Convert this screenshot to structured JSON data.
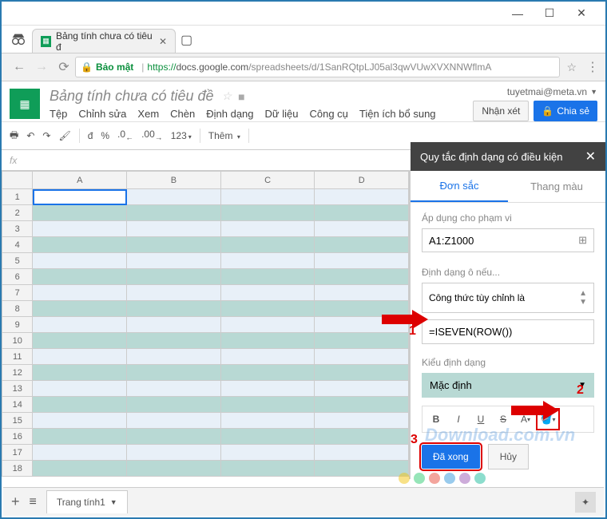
{
  "window": {
    "min": "—",
    "max": "☐",
    "close": "✕"
  },
  "browser": {
    "tab_title": "Bảng tính chưa có tiêu đ",
    "security": "Bảo mật",
    "url_prefix": "https://",
    "url_host": "docs.google.com",
    "url_path": "/spreadsheets/d/1SanRQtpLJ05al3qwVUwXVXNNWflmA"
  },
  "app": {
    "title": "Bảng tính chưa có tiêu đề",
    "email": "tuyetmai@meta.vn",
    "comments_btn": "Nhận xét",
    "share_btn": "Chia sẻ",
    "menus": [
      "Tệp",
      "Chỉnh sửa",
      "Xem",
      "Chèn",
      "Định dạng",
      "Dữ liệu",
      "Công cụ",
      "Tiện ích bổ sung"
    ]
  },
  "toolbar": {
    "currency": "đ",
    "percent": "%",
    "dec_dec": ".0",
    "inc_dec": ".00",
    "numfmt": "123",
    "more": "Thêm"
  },
  "sheet": {
    "columns": [
      "A",
      "B",
      "C",
      "D"
    ],
    "rows": 18,
    "active_tab": "Trang tính1"
  },
  "panel": {
    "title": "Quy tắc định dạng có điều kiện",
    "tab_single": "Đơn sắc",
    "tab_scale": "Thang màu",
    "range_label": "Áp dụng cho phạm vi",
    "range_value": "A1:Z1000",
    "cond_label": "Định dạng ô nếu...",
    "cond_select": "Công thức tùy chỉnh là",
    "formula_value": "=ISEVEN(ROW())",
    "style_label": "Kiểu định dạng",
    "style_preview": "Mặc định",
    "done_btn": "Đã xong",
    "cancel_btn": "Hủy"
  },
  "annotations": {
    "n1": "1",
    "n2": "2",
    "n3": "3"
  },
  "watermark": "Download.com.vn",
  "chart_data": null
}
